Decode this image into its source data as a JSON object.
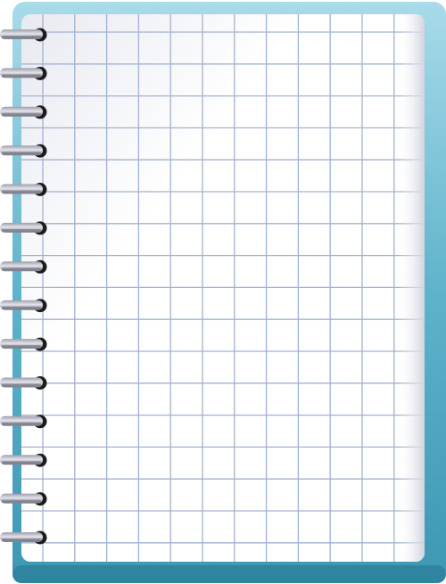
{
  "notebook": {
    "cover_color": "#4aa6bf",
    "cover_highlight": "#9fd6e6",
    "cover_shadow": "#2f7f97",
    "page_color": "#ffffff",
    "page_shade": "#d9dce6",
    "grid_color": "#9fb3cf",
    "ring_dark": "#1c1c1e",
    "ring_metal": "#b7b8c3",
    "ring_count": 14
  }
}
